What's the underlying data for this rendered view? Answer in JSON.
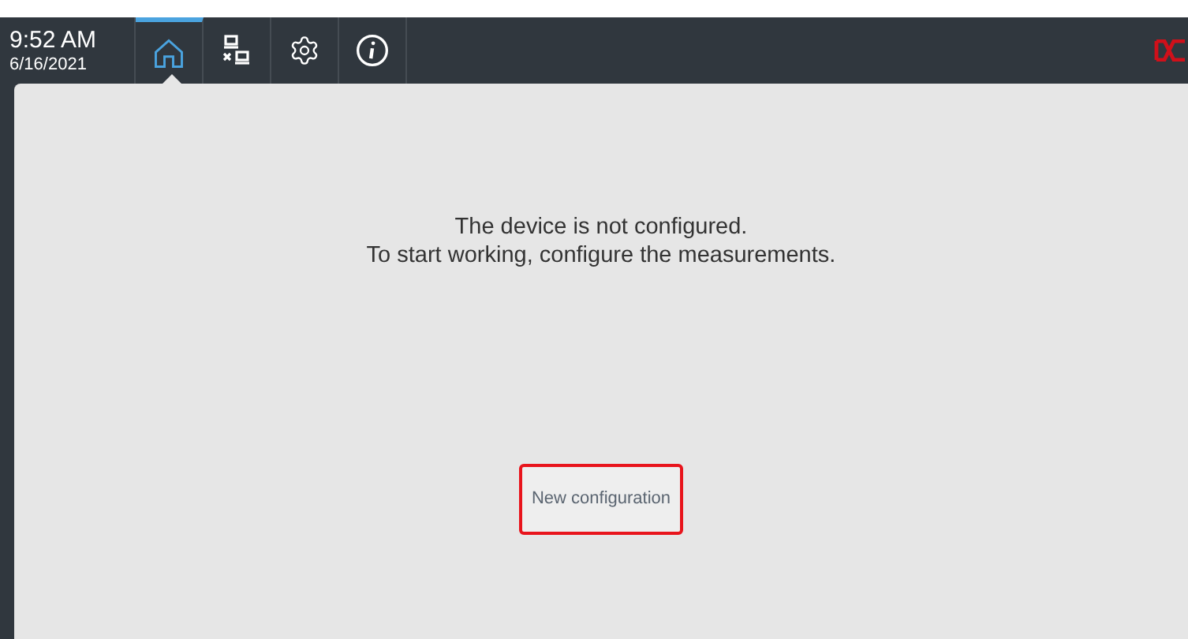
{
  "clock": {
    "time": "9:52 AM",
    "date": "6/16/2021"
  },
  "tabs": [
    {
      "kind": "home",
      "selected": true
    },
    {
      "kind": "network",
      "selected": false
    },
    {
      "kind": "settings",
      "selected": false
    },
    {
      "kind": "info",
      "selected": false
    }
  ],
  "message": [
    "The device is not configured.",
    "To start working, configure the measurements."
  ],
  "button": {
    "label": "New configuration",
    "highlighted": true
  }
}
